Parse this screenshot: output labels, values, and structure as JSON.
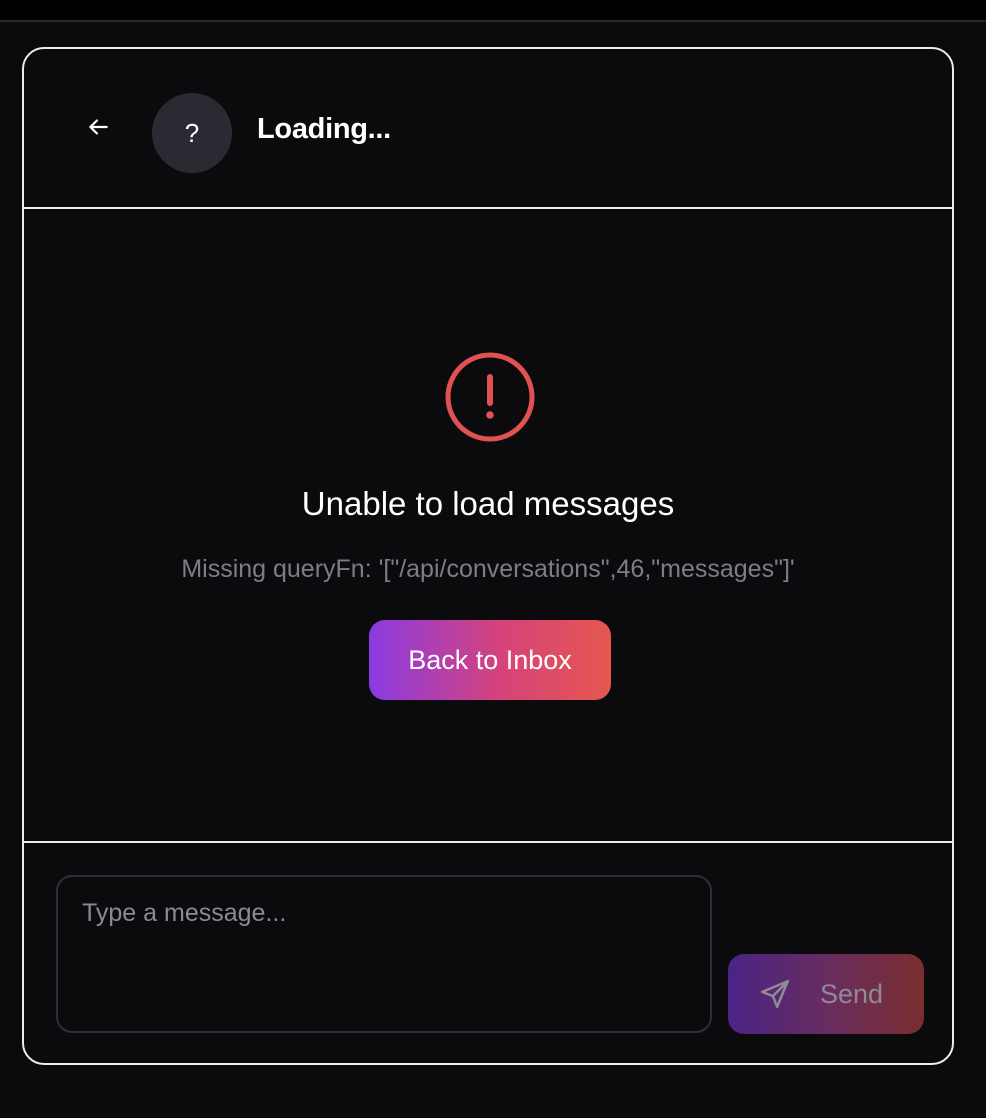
{
  "header": {
    "title": "Loading...",
    "avatar_placeholder": "?"
  },
  "error": {
    "title": "Unable to load messages",
    "detail": "Missing queryFn: '[\"/api/conversations\",46,\"messages\"]'",
    "color": "#e05252"
  },
  "actions": {
    "back_to_inbox_label": "Back to Inbox"
  },
  "composer": {
    "placeholder": "Type a message...",
    "send_label": "Send"
  },
  "icons": {
    "back": "arrow-left-icon",
    "error": "alert-circle-icon",
    "send": "send-icon"
  }
}
